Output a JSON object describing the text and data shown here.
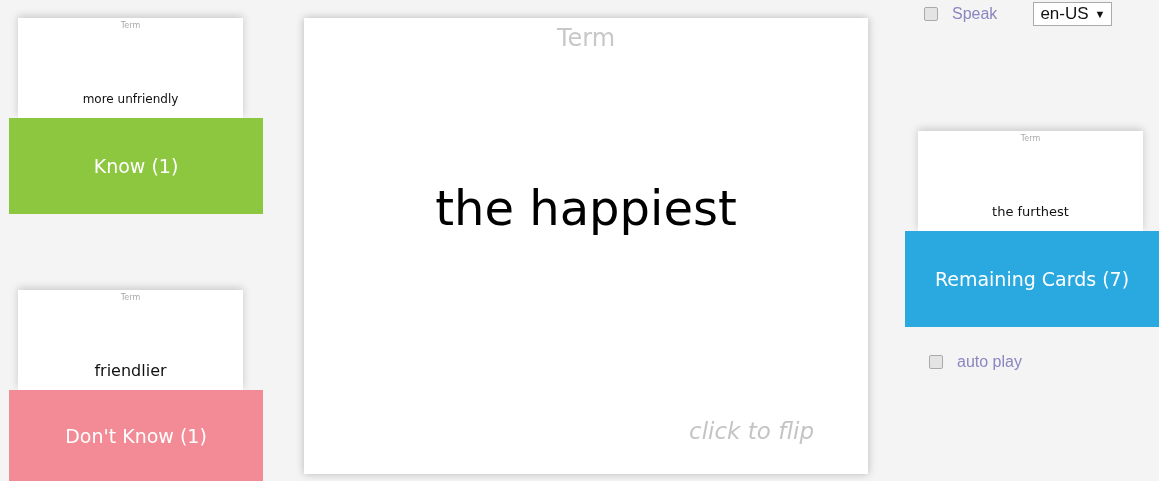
{
  "know_pile": {
    "card": {
      "label": "Term",
      "text": "more unfriendly"
    },
    "button": "Know (1)"
  },
  "dont_know_pile": {
    "card": {
      "label": "Term",
      "text": "friendlier"
    },
    "button": "Don't Know (1)"
  },
  "current_card": {
    "label": "Term",
    "text": "the happiest",
    "hint": "click to flip"
  },
  "speak": {
    "label": "Speak",
    "checked": false,
    "language": "en-US",
    "caret": "▼"
  },
  "remaining_pile": {
    "card": {
      "label": "Term",
      "text": "the furthest"
    },
    "button": "Remaining Cards (7)"
  },
  "auto_play": {
    "label": "auto play",
    "checked": false
  }
}
